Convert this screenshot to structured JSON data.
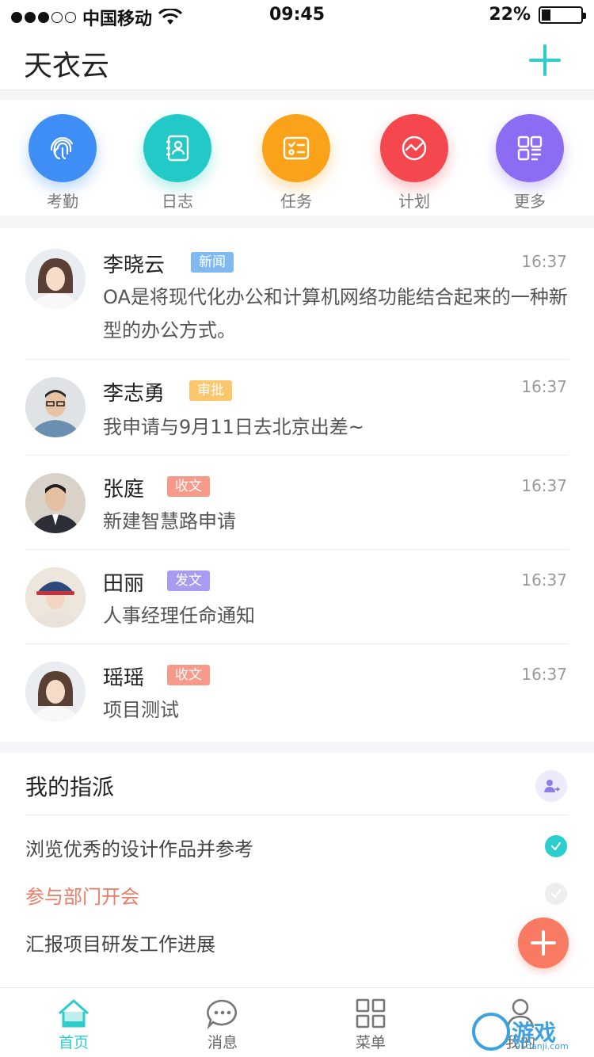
{
  "status_bar": {
    "carrier": "中国移动",
    "time": "09:45",
    "battery": "22%",
    "battery_level": 0.22
  },
  "header": {
    "title": "天衣云",
    "add_icon": "plus-icon",
    "accent_color": "#2ccdcd"
  },
  "quick_actions": [
    {
      "label": "考勤",
      "icon": "fingerprint-icon",
      "color": "#3f8ef5"
    },
    {
      "label": "日志",
      "icon": "contact-book-icon",
      "color": "#22c9c6"
    },
    {
      "label": "任务",
      "icon": "checklist-icon",
      "color": "#f9a21a"
    },
    {
      "label": "计划",
      "icon": "trend-icon",
      "color": "#f4474e"
    },
    {
      "label": "更多",
      "icon": "grid-more-icon",
      "color": "#8c6cf3"
    }
  ],
  "messages": [
    {
      "name": "李晓云",
      "tag": "新闻",
      "tag_color": "#7fb9f0",
      "time": "16:37",
      "body": "OA是将现代化办公和计算机网络功能结合起来的一种新型的办公方式。"
    },
    {
      "name": "李志勇",
      "tag": "审批",
      "tag_color": "#fbc66c",
      "time": "16:37",
      "body": "我申请与9月11日去北京出差~"
    },
    {
      "name": "张庭",
      "tag": "收文",
      "tag_color": "#f79a8a",
      "time": "16:37",
      "body": "新建智慧路申请"
    },
    {
      "name": "田丽",
      "tag": "发文",
      "tag_color": "#a99bf0",
      "time": "16:37",
      "body": "人事经理任命通知"
    },
    {
      "name": "瑶瑶",
      "tag": "收文",
      "tag_color": "#f79a8a",
      "time": "16:37",
      "body": "项目测试"
    }
  ],
  "assignments": {
    "title": "我的指派",
    "user_icon": "user-assign-icon",
    "tasks": [
      {
        "text": "浏览优秀的设计作品并参考",
        "done": true
      },
      {
        "text": "参与部门开会",
        "done": false
      },
      {
        "text": "汇报项目研发工作进展",
        "done": false
      }
    ]
  },
  "fab": {
    "icon": "plus-icon",
    "color": "#f97a62"
  },
  "tabbar": [
    {
      "label": "首页",
      "icon": "home-icon",
      "active": true
    },
    {
      "label": "消息",
      "icon": "chat-bubble-icon",
      "active": false
    },
    {
      "label": "菜单",
      "icon": "grid-menu-icon",
      "active": false
    },
    {
      "label": "我的",
      "icon": "person-icon",
      "active": false
    }
  ],
  "watermark": {
    "text": "游戏",
    "sub": "91danji.com"
  }
}
